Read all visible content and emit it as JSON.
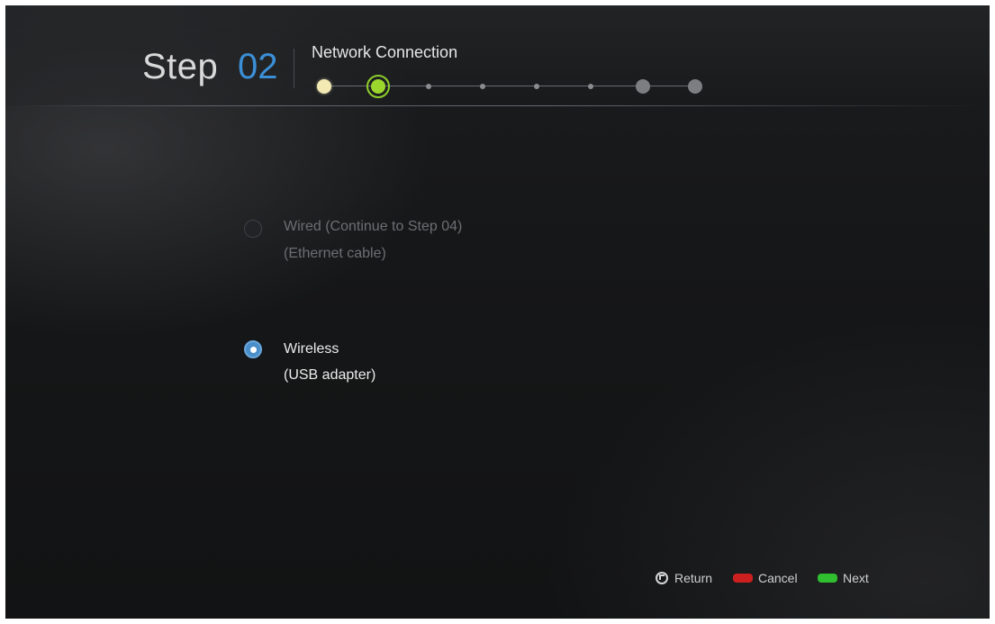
{
  "header": {
    "step_label": "Step",
    "step_number": "02",
    "title": "Network Connection"
  },
  "progress": {
    "total_steps": 8,
    "current_step": 2,
    "colors": {
      "completed": "#f2e9b3",
      "current": "#9bd62c",
      "pending": "#7c7e82"
    }
  },
  "options": [
    {
      "line1": "Wired (Continue to Step 04)",
      "line2": "(Ethernet cable)",
      "selected": false,
      "enabled": false
    },
    {
      "line1": "Wireless",
      "line2": "(USB adapter)",
      "selected": true,
      "enabled": true
    }
  ],
  "footer": {
    "return_label": "Return",
    "cancel_label": "Cancel",
    "next_label": "Next",
    "cancel_color": "#cc1f1f",
    "next_color": "#2fbf2f"
  },
  "colors": {
    "accent": "#3b8fd6"
  }
}
